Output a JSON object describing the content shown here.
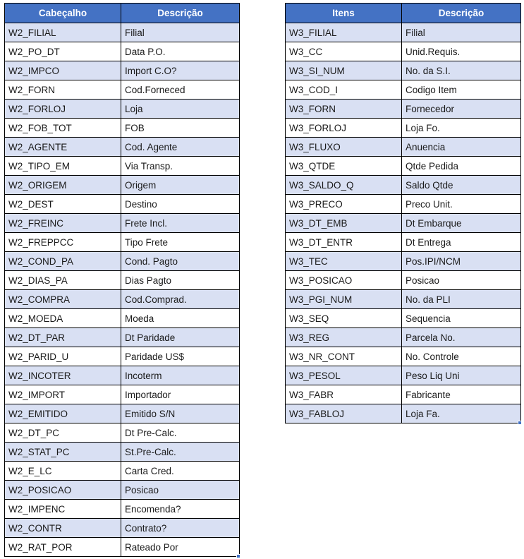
{
  "colors": {
    "header_bg": "#4472C4",
    "header_text": "#FFFFFF",
    "band_row_bg": "#D9E0F3",
    "plain_row_bg": "#FFFFFF",
    "grid_line": "#000000",
    "cell_text": "#1A1A1A"
  },
  "tables": [
    {
      "id": "cabecalho",
      "headers": [
        "Cabeçalho",
        "Descrição"
      ],
      "rows": [
        [
          "W2_FILIAL",
          "Filial"
        ],
        [
          "W2_PO_DT",
          "Data P.O."
        ],
        [
          "W2_IMPCO",
          "Import C.O?"
        ],
        [
          "W2_FORN",
          "Cod.Forneced"
        ],
        [
          "W2_FORLOJ",
          "Loja"
        ],
        [
          "W2_FOB_TOT",
          "FOB"
        ],
        [
          "W2_AGENTE",
          "Cod. Agente"
        ],
        [
          "W2_TIPO_EM",
          "Via Transp."
        ],
        [
          "W2_ORIGEM",
          "Origem"
        ],
        [
          "W2_DEST",
          "Destino"
        ],
        [
          "W2_FREINC",
          "Frete Incl."
        ],
        [
          "W2_FREPPCC",
          "Tipo Frete"
        ],
        [
          "W2_COND_PA",
          "Cond. Pagto"
        ],
        [
          "W2_DIAS_PA",
          "Dias  Pagto"
        ],
        [
          "W2_COMPRA",
          "Cod.Comprad."
        ],
        [
          "W2_MOEDA",
          "Moeda"
        ],
        [
          "W2_DT_PAR",
          "Dt Paridade"
        ],
        [
          "W2_PARID_U",
          "Paridade US$"
        ],
        [
          "W2_INCOTER",
          "Incoterm"
        ],
        [
          "W2_IMPORT",
          "Importador"
        ],
        [
          "W2_EMITIDO",
          "Emitido S/N"
        ],
        [
          "W2_DT_PC",
          "Dt Pre-Calc."
        ],
        [
          "W2_STAT_PC",
          "St.Pre-Calc."
        ],
        [
          "W2_E_LC",
          "Carta Cred."
        ],
        [
          "W2_POSICAO",
          "Posicao"
        ],
        [
          "W2_IMPENC",
          "Encomenda?"
        ],
        [
          "W2_CONTR",
          "Contrato?"
        ],
        [
          "W2_RAT_POR",
          "Rateado Por"
        ]
      ]
    },
    {
      "id": "itens",
      "headers": [
        "Itens",
        "Descrição"
      ],
      "rows": [
        [
          "W3_FILIAL",
          "Filial"
        ],
        [
          "W3_CC",
          "Unid.Requis."
        ],
        [
          "W3_SI_NUM",
          "No. da S.I."
        ],
        [
          "W3_COD_I",
          "Codigo Item"
        ],
        [
          "W3_FORN",
          "Fornecedor"
        ],
        [
          "W3_FORLOJ",
          "Loja Fo."
        ],
        [
          "W3_FLUXO",
          "Anuencia"
        ],
        [
          "W3_QTDE",
          "Qtde Pedida"
        ],
        [
          "W3_SALDO_Q",
          "Saldo Qtde"
        ],
        [
          "W3_PRECO",
          "Preco Unit."
        ],
        [
          "W3_DT_EMB",
          "Dt Embarque"
        ],
        [
          "W3_DT_ENTR",
          "Dt Entrega"
        ],
        [
          "W3_TEC",
          "Pos.IPI/NCM"
        ],
        [
          "W3_POSICAO",
          "Posicao"
        ],
        [
          "W3_PGI_NUM",
          "No. da PLI"
        ],
        [
          "W3_SEQ",
          "Sequencia"
        ],
        [
          "W3_REG",
          "Parcela No."
        ],
        [
          "W3_NR_CONT",
          "No. Controle"
        ],
        [
          "W3_PESOL",
          "Peso Liq Uni"
        ],
        [
          "W3_FABR",
          "Fabricante"
        ],
        [
          "W3_FABLOJ",
          "Loja Fa."
        ]
      ]
    }
  ]
}
